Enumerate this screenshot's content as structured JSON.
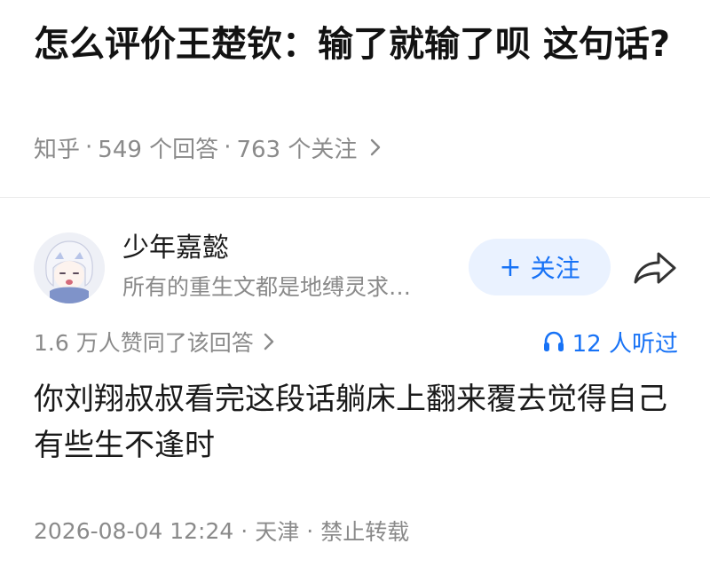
{
  "question": {
    "title": "怎么评价王楚钦：输了就输了呗 这句话?"
  },
  "meta": {
    "source": "知乎",
    "separator": "·",
    "answers": "549 个回答",
    "followers": "763 个关注"
  },
  "author": {
    "name": "少年嘉懿",
    "bio": "所有的重生文都是地缚灵求…",
    "follow_label": "关注",
    "follow_plus": "+"
  },
  "stats": {
    "approvals": "1.6 万人赞同了该回答",
    "listeners": "12 人听过"
  },
  "answer": {
    "text": "你刘翔叔叔看完这段话躺床上翻来覆去觉得自己有些生不逢时"
  },
  "footer": {
    "date": "2026-08-04 12:24",
    "location": "天津",
    "copyright": "禁止转载"
  },
  "icons": {
    "chevron": "chevron-right-icon",
    "share": "share-icon",
    "headphone": "headphone-icon"
  },
  "colors": {
    "accent": "#1772f6",
    "follow_bg": "#eaf2ff",
    "muted": "#8a8a8a"
  }
}
